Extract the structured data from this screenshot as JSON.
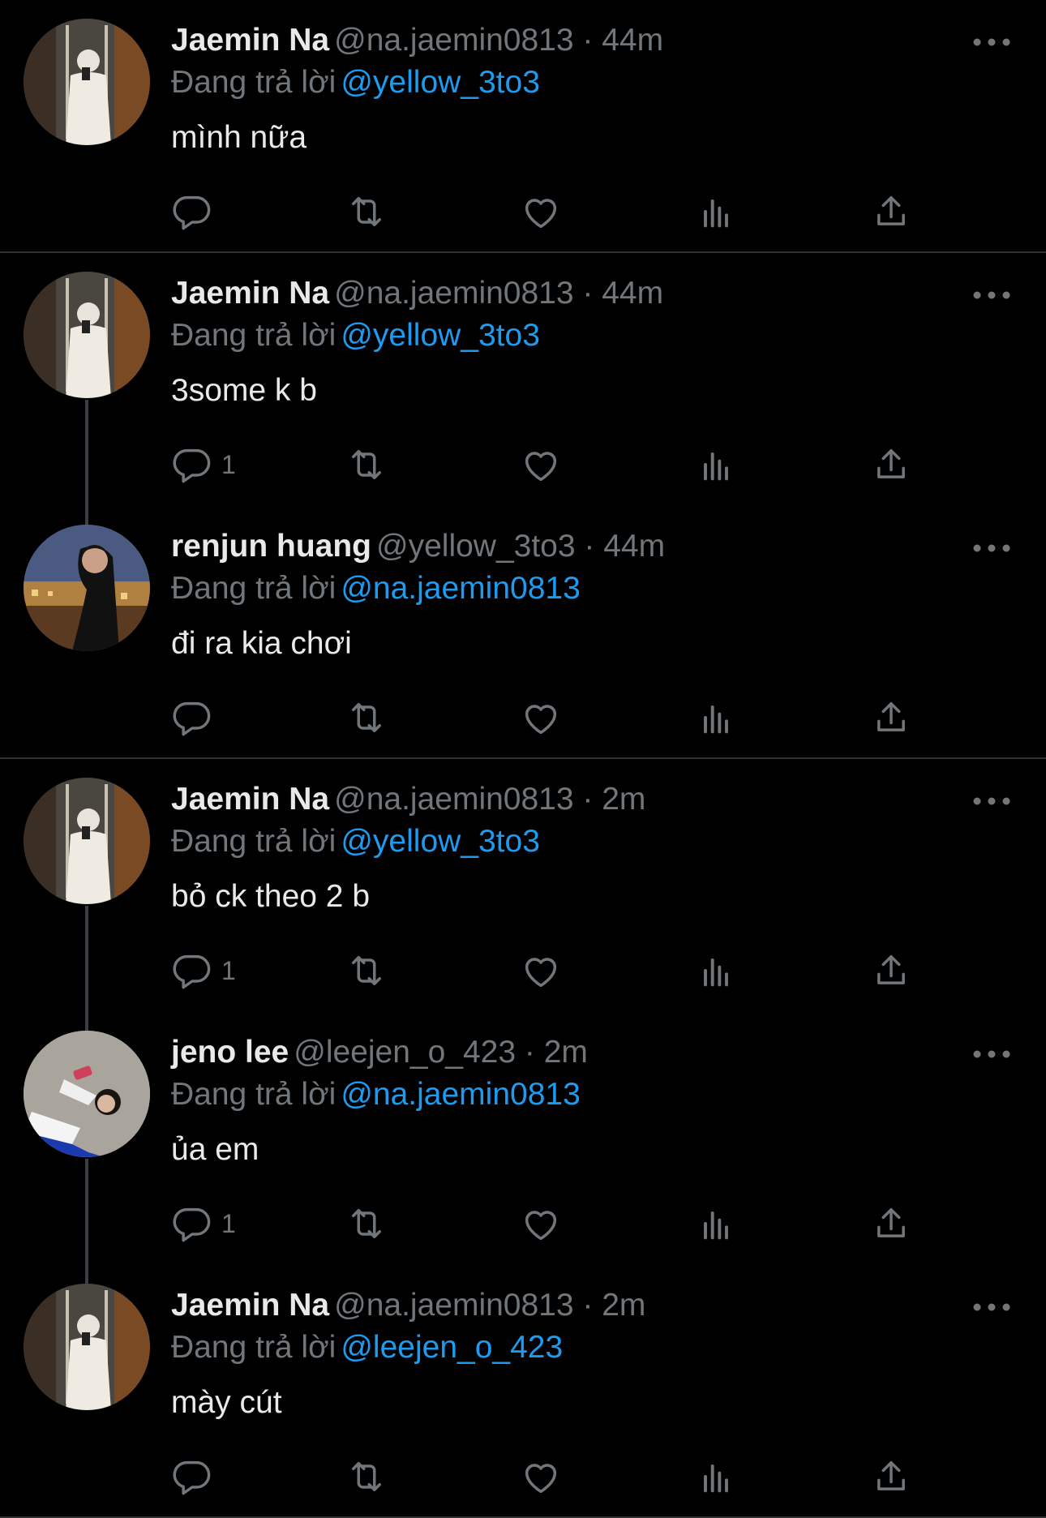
{
  "reply_prefix": "Đang trả lời",
  "colors": {
    "background": "#000000",
    "text": "#e7e9ea",
    "secondary": "#71767b",
    "mention": "#1d9bf0",
    "divider": "#2f3336"
  },
  "tweets": [
    {
      "name": "Jaemin Na",
      "meta": "@na.jaemin0813 · 44m",
      "reply_to": "@yellow_3to3",
      "text": "mình nữa",
      "reply_count": ""
    },
    {
      "name": "Jaemin Na",
      "meta": "@na.jaemin0813 · 44m",
      "reply_to": "@yellow_3to3",
      "text": "3some k b",
      "reply_count": "1"
    },
    {
      "name": "renjun huang",
      "meta": "@yellow_3to3 · 44m",
      "reply_to": "@na.jaemin0813",
      "text": "đi ra kia chơi",
      "reply_count": ""
    },
    {
      "name": "Jaemin Na",
      "meta": "@na.jaemin0813 · 2m",
      "reply_to": "@yellow_3to3",
      "text": "bỏ ck theo 2 b",
      "reply_count": "1"
    },
    {
      "name": "jeno lee",
      "meta": "@leejen_o_423 · 2m",
      "reply_to": "@na.jaemin0813",
      "text": "ủa em",
      "reply_count": "1"
    },
    {
      "name": "Jaemin Na",
      "meta": "@na.jaemin0813 · 2m",
      "reply_to": "@leejen_o_423",
      "text": "mày cút",
      "reply_count": ""
    }
  ],
  "icons": {
    "reply": "reply-icon",
    "retweet": "retweet-icon",
    "like": "heart-icon",
    "views": "views-icon",
    "share": "share-icon",
    "more": "more-icon"
  }
}
